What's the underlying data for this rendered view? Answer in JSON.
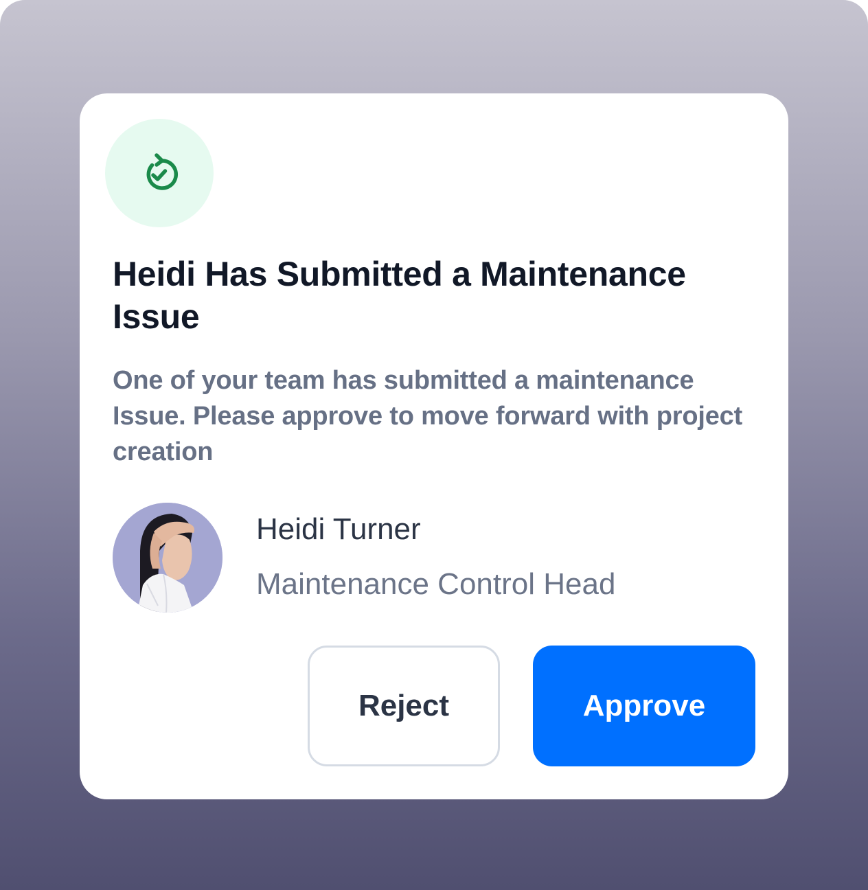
{
  "dialog": {
    "status_icon": "refresh-check-icon",
    "title": "Heidi Has Submitted a Maintenance Issue",
    "description": "One of your team has submitted a maintenance Issue. Please approve to move forward with project creation"
  },
  "submitter": {
    "name": "Heidi Turner",
    "role": "Maintenance Control Head",
    "avatar_icon": "user-avatar-photo"
  },
  "actions": {
    "reject_label": "Reject",
    "approve_label": "Approve"
  },
  "colors": {
    "accent": "#0070FF",
    "success_icon": "#1A8A4A",
    "success_bg": "#E6FAF0",
    "title_text": "#111827",
    "muted_text": "#667085"
  }
}
